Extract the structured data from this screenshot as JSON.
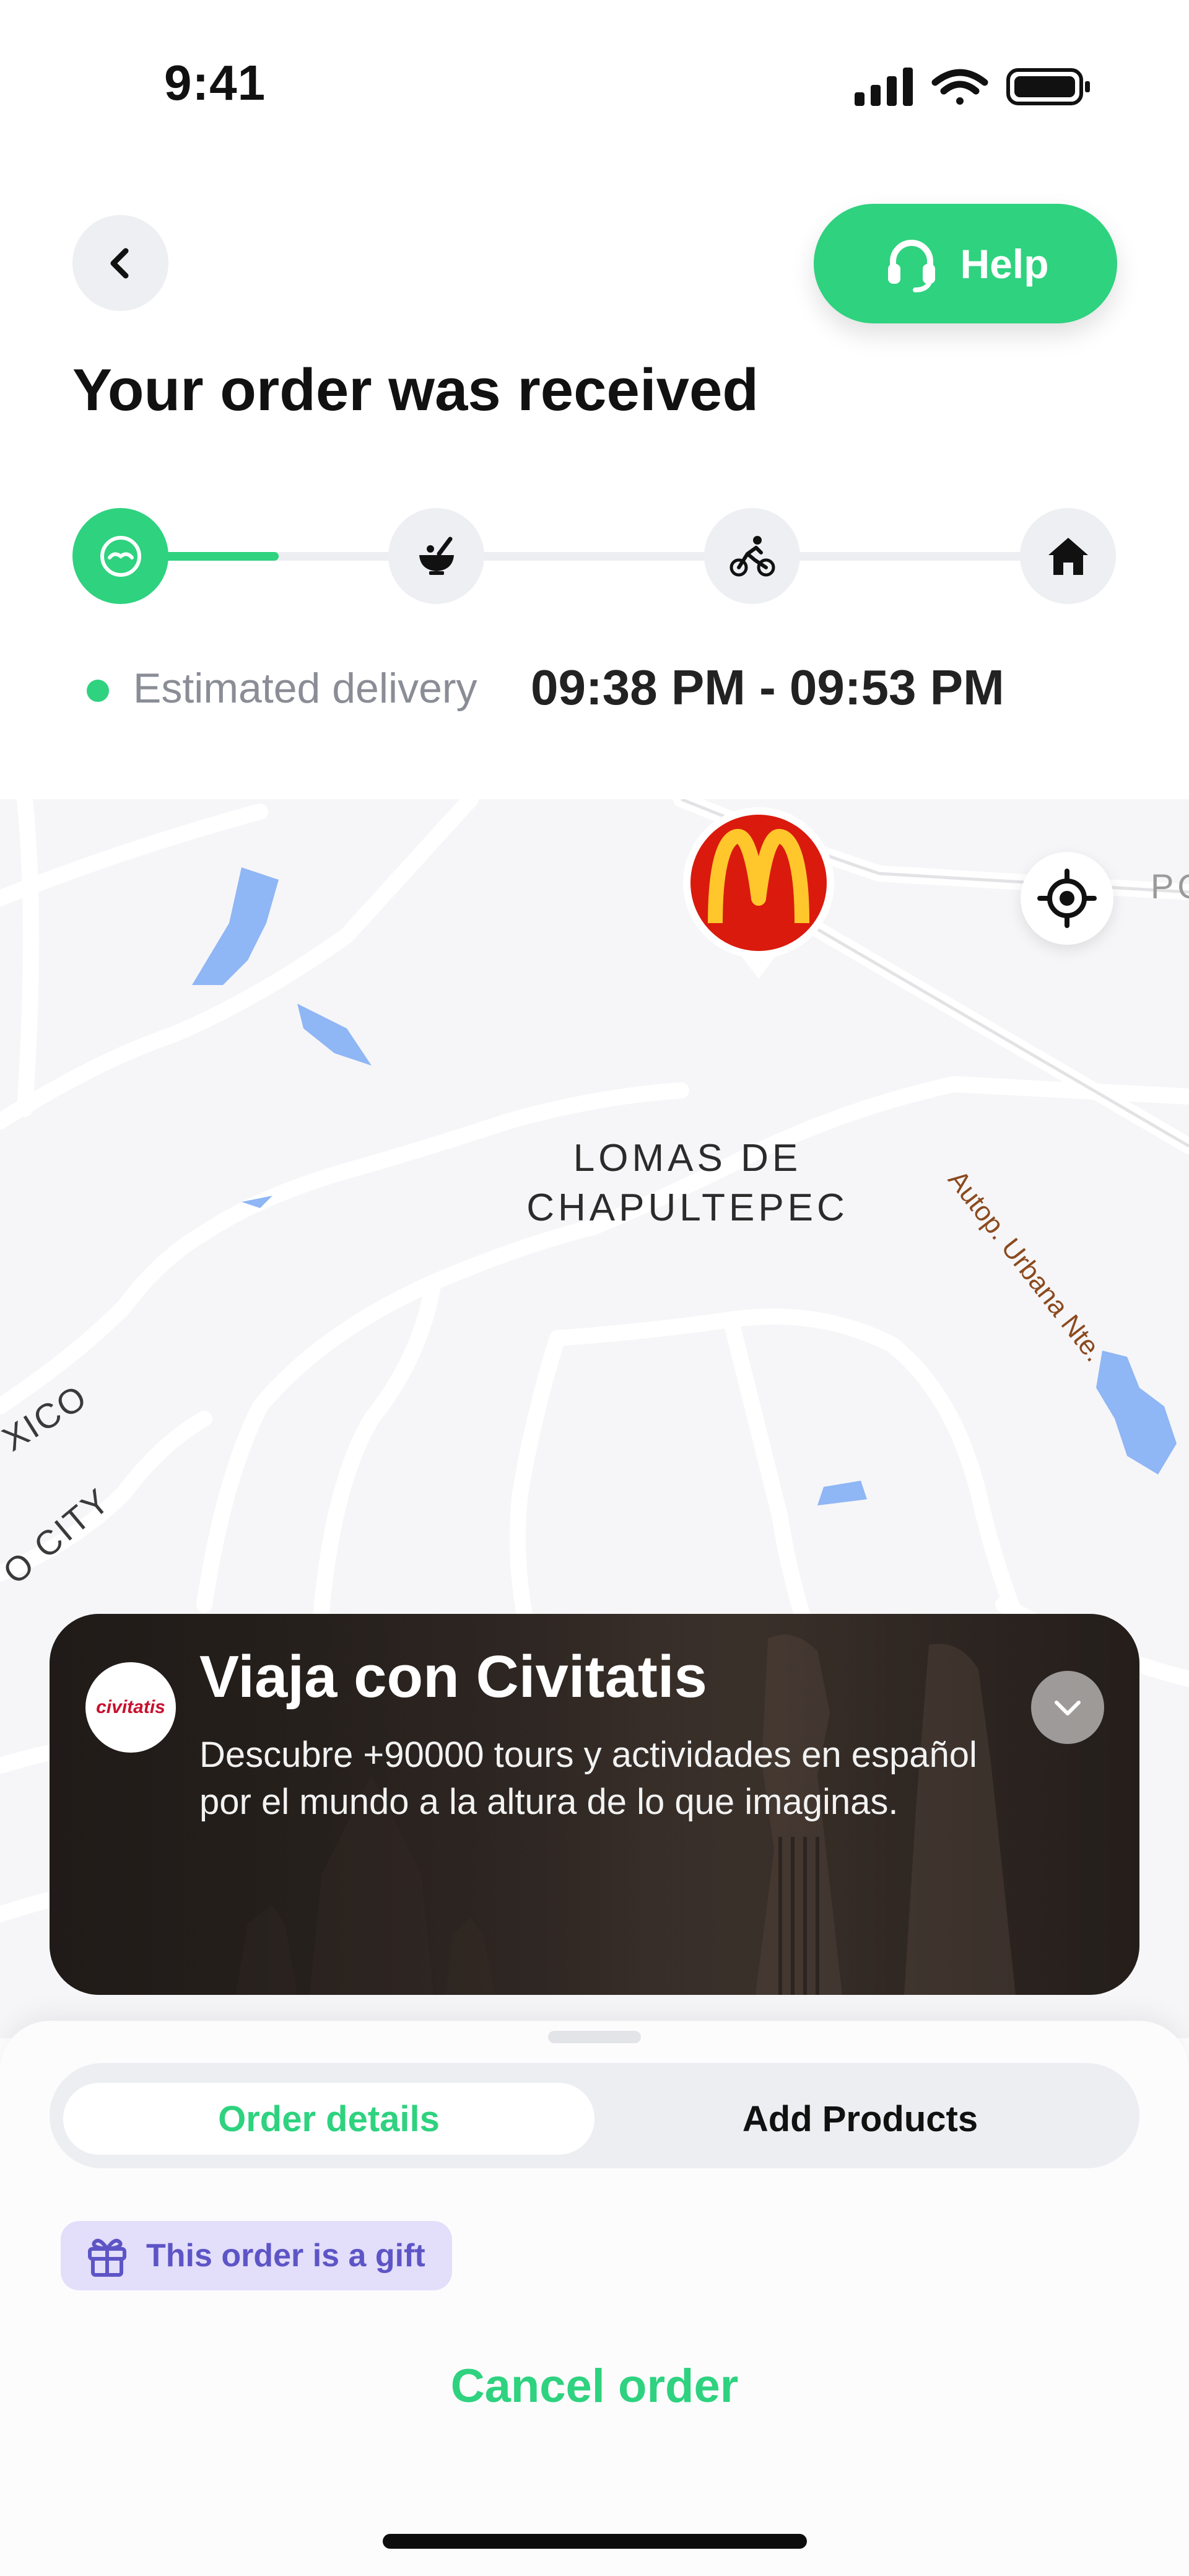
{
  "status_bar": {
    "time": "9:41",
    "icons": [
      "signal-icon",
      "wifi-icon",
      "battery-icon"
    ]
  },
  "header": {
    "back_icon": "chevron-left-icon",
    "help_label": "Help",
    "help_icon": "headset-icon",
    "title": "Your order was received"
  },
  "progress": {
    "steps": [
      {
        "name": "order-received",
        "icon": "order-icon",
        "state": "active"
      },
      {
        "name": "preparing",
        "icon": "bowl-icon",
        "state": "pending"
      },
      {
        "name": "on-the-way",
        "icon": "cyclist-icon",
        "state": "pending"
      },
      {
        "name": "delivered",
        "icon": "house-icon",
        "state": "pending"
      }
    ],
    "completed_fraction": 0.17,
    "eta_label": "Estimated delivery",
    "eta_value": "09:38 PM - 09:53 PM"
  },
  "map": {
    "area_label_line1": "LOMAS DE",
    "area_label_line2": "CHAPULTEPEC",
    "road_label": "Autop. Urbana Nte.",
    "city_label_1": "XICO",
    "city_label_2": "O CITY",
    "corner_label": "PO",
    "restaurant_pin": "mcdonalds-pin",
    "locate_icon": "locate-icon",
    "colors": {
      "water": "#8fb6f5",
      "background": "#f6f6f8",
      "roads": "#ffffff"
    }
  },
  "ad": {
    "brand": "civitatis",
    "title": "Viaja con Civitatis",
    "description": "Descubre +90000 tours y actividades en español por el mundo a la altura de lo que imaginas.",
    "collapse_icon": "chevron-down-icon"
  },
  "sheet": {
    "tabs": [
      {
        "label": "Order details",
        "active": true
      },
      {
        "label": "Add Products",
        "active": false
      }
    ],
    "gift_badge": "This order is a gift",
    "gift_icon": "gift-icon",
    "cancel_label": "Cancel order"
  },
  "colors": {
    "accent": "#2ed27f",
    "gift_bg": "#e3defa",
    "gift_text": "#5d55c6",
    "mcdonalds_red": "#da1a0d",
    "mcdonalds_yellow": "#ffc72c"
  }
}
